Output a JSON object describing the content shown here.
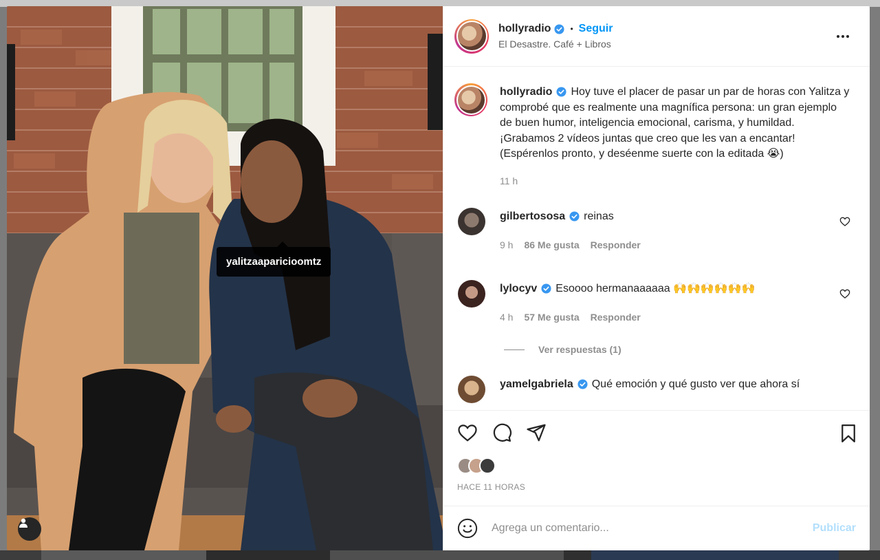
{
  "post": {
    "author": "hollyradio",
    "follow_label": "Seguir",
    "location": "El Desastre. Café + Libros",
    "photo_tag": "yalitzaaparicioomtz"
  },
  "caption": {
    "author": "hollyradio",
    "text": "Hoy tuve el placer de pasar un par de horas con Yalitza y comprobé que es realmente una magnífica persona: un gran ejemplo de buen humor, inteligencia emocional, carisma, y humildad. ¡Grabamos 2 vídeos juntas que creo que les van a encantar!\n(Espérenlos pronto, y deséenme suerte con la editada 😭)",
    "time": "11 h"
  },
  "comments": [
    {
      "author": "gilbertososa",
      "text": "reinas",
      "time": "9 h",
      "likes": "86 Me gusta",
      "reply": "Responder"
    },
    {
      "author": "lylocyv",
      "text": "Esoooo hermanaaaaaa 🙌🙌🙌🙌🙌🙌",
      "time": "4 h",
      "likes": "57 Me gusta",
      "reply": "Responder"
    }
  ],
  "view_replies": "Ver respuestas (1)",
  "partial_comment": {
    "author": "yamelgabriela",
    "text": "Qué emoción y qué gusto ver que ahora sí"
  },
  "footer": {
    "timestamp": "HACE 11 HORAS",
    "comment_placeholder": "Agrega un comentario...",
    "publish_label": "Publicar"
  },
  "colors": {
    "link": "#0095f6",
    "publish_disabled": "#b2dffc",
    "muted": "#8e8e8e"
  },
  "icons": [
    "heart-icon",
    "comment-icon",
    "share-icon",
    "bookmark-icon",
    "more-options-icon",
    "emoji-icon",
    "user-tag-icon",
    "verified-badge-icon"
  ]
}
